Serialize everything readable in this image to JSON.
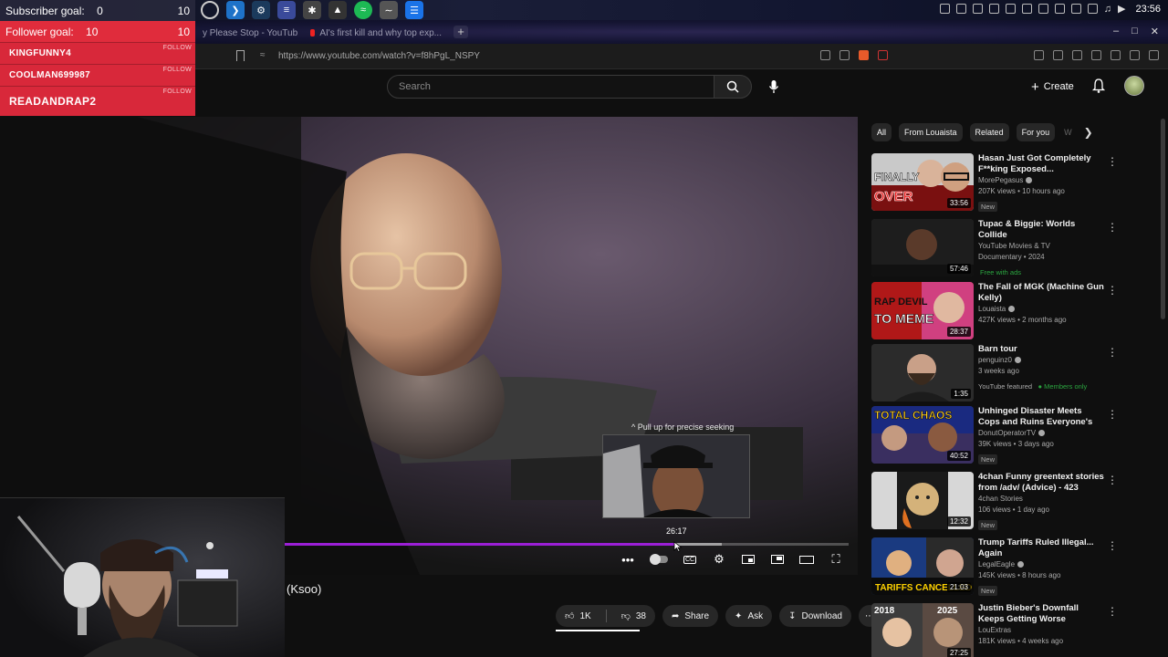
{
  "overlay": {
    "subscriber_goal_label": "Subscriber goal:",
    "subscriber_goal_current": "0",
    "subscriber_goal_target": "10",
    "follower_goal_label": "Follower goal:",
    "follower_goal_current": "10",
    "follower_goal_target": "10",
    "recent_followers": [
      "KINGFUNNY4",
      "COOLMAN699987",
      "READANDRAP2"
    ],
    "follow_tag": "FOLLOW"
  },
  "taskbar": {
    "clock": "23:56"
  },
  "browser": {
    "tabs": [
      {
        "label": "y Please Stop - YouTube"
      },
      {
        "label": "AI's first kill and why top exp..."
      }
    ],
    "new_tab": "+",
    "url": "https://www.youtube.com/watch?v=f8hPgL_NSPY"
  },
  "youtube": {
    "search_placeholder": "Search",
    "create_label": "Create"
  },
  "player": {
    "seek_hint": "^ Pull up for precise seeking",
    "preview_time": "26:17",
    "progress_fraction": 0.694,
    "buffered_fraction": 0.775
  },
  "video": {
    "title_fragment": "(Ksoo)",
    "likes": "1K",
    "dislikes": "38",
    "share_label": "Share",
    "ask_label": "Ask",
    "download_label": "Download"
  },
  "chips": [
    "All",
    "From Louaista",
    "Related",
    "For you",
    "W"
  ],
  "recommendations": [
    {
      "title": "Hasan Just Got Completely F**king Exposed...",
      "channel": "MorePegasus",
      "verified": true,
      "meta": "207K views • 10 hours ago",
      "badge": "New",
      "duration": "33:56",
      "thumb_colors": [
        "#c8c8c8",
        "#7a1010"
      ],
      "thumb_text": "FINALLY OVER"
    },
    {
      "title": "Tupac & Biggie: Worlds Collide",
      "channel": "YouTube Movies & TV",
      "verified": false,
      "meta": "Documentary • 2024",
      "badge": "Free with ads",
      "duration": "57:46",
      "thumb_colors": [
        "#2a2a2a",
        "#5a4a3a"
      ],
      "thumb_text": ""
    },
    {
      "title": "The Fall of MGK (Machine Gun Kelly)",
      "channel": "Louaista",
      "verified": true,
      "meta": "427K views • 2 months ago",
      "badge": "",
      "duration": "28:37",
      "thumb_colors": [
        "#b01818",
        "#d04080"
      ],
      "thumb_text": "RAP DEVIL TO MEME"
    },
    {
      "title": "Barn tour",
      "channel": "penguinz0",
      "verified": true,
      "meta": "3 weeks ago",
      "badge": "YouTube featured",
      "badge2": "Members only",
      "duration": "1:35",
      "thumb_colors": [
        "#3a3a3a",
        "#1c1c1c"
      ],
      "thumb_text": ""
    },
    {
      "title": "Unhinged Disaster Meets Cops and Ruins Everyone's Night",
      "channel": "DonutOperatorTV",
      "verified": true,
      "meta": "39K views • 3 days ago",
      "badge": "New",
      "duration": "40:52",
      "thumb_colors": [
        "#1a2a80",
        "#e0a020"
      ],
      "thumb_text": "TOTAL CHAOS"
    },
    {
      "title": "4chan Funny greentext stories from /adv/ (Advice) - 423",
      "channel": "4chan Stories",
      "verified": false,
      "meta": "106 views • 1 day ago",
      "badge": "New",
      "duration": "12:32",
      "thumb_colors": [
        "#d0d0d0",
        "#c08040"
      ],
      "thumb_text": ""
    },
    {
      "title": "Trump Tariffs Ruled Illegal... Again",
      "channel": "LegalEagle",
      "verified": true,
      "meta": "145K views • 8 hours ago",
      "badge": "New",
      "duration": "21:03",
      "thumb_colors": [
        "#1a3a80",
        "#d02020"
      ],
      "thumb_text": "TARIFFS CANCELLED"
    },
    {
      "title": "Justin Bieber's Downfall Keeps Getting Worse",
      "channel": "LouExtras",
      "verified": false,
      "meta": "181K views • 4 weeks ago",
      "badge": "",
      "duration": "27:25",
      "thumb_colors": [
        "#444444",
        "#8a7060"
      ],
      "thumb_text": "2018 2025"
    }
  ]
}
